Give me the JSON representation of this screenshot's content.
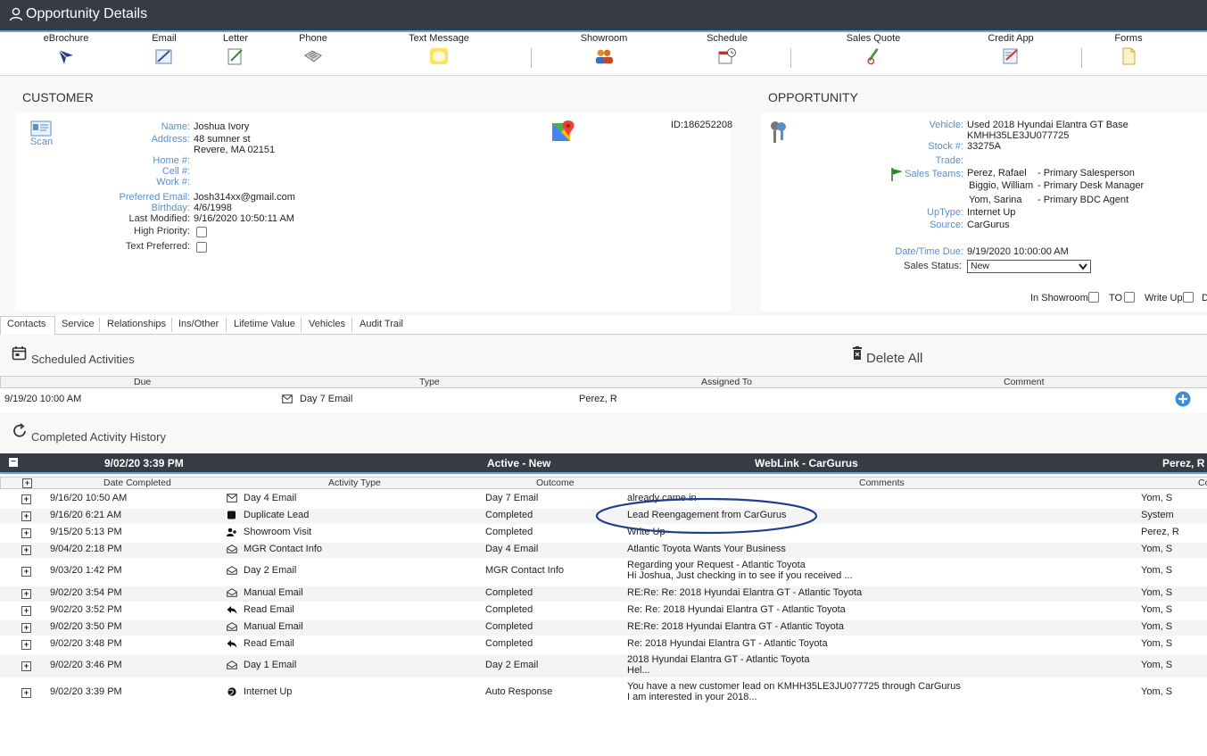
{
  "window": {
    "title": "Opportunity Details"
  },
  "toolbar": [
    {
      "label": "eBrochure"
    },
    {
      "label": "Email"
    },
    {
      "label": "Letter"
    },
    {
      "label": "Phone"
    },
    {
      "label": "Text Message"
    },
    {
      "label": "Showroom"
    },
    {
      "label": "Schedule"
    },
    {
      "label": "Sales Quote"
    },
    {
      "label": "Credit App"
    },
    {
      "label": "Forms"
    }
  ],
  "customer": {
    "header": "CUSTOMER",
    "scan_label": "Scan",
    "id": "ID:186252208",
    "name_label": "Name:",
    "name": "Joshua Ivory",
    "address_label": "Address:",
    "address1": "48 sumner st",
    "address2": "Revere, MA 02151",
    "home_label": "Home #:",
    "cell_label": "Cell #:",
    "work_label": "Work #:",
    "email_label": "Preferred Email:",
    "email": "Josh314xx@gmail.com",
    "birthday_label": "Birthday:",
    "birthday": "4/6/1998",
    "modified_label": "Last Modified:",
    "modified": "9/16/2020 10:50:11 AM",
    "priority_label": "High Priority:",
    "text_pref_label": "Text Preferred:"
  },
  "opportunity": {
    "header": "OPPORTUNITY",
    "vehicle_label": "Vehicle:",
    "vehicle": "Used 2018 Hyundai Elantra GT Base",
    "vin": "KMHH35LE3JU077725",
    "stock_label": "Stock #:",
    "stock": "33275A",
    "trade_label": "Trade:",
    "teams_label": "Sales Teams:",
    "teams": [
      {
        "name": "Perez, Rafael",
        "role": "- Primary Salesperson"
      },
      {
        "name": "Biggio, William",
        "role": "- Primary Desk Manager"
      },
      {
        "name": "Yom, Sarina",
        "role": "- Primary BDC Agent"
      }
    ],
    "uptype_label": "UpType:",
    "uptype": "Internet Up",
    "source_label": "Source:",
    "source": "CarGurus",
    "due_label": "Date/Time Due:",
    "due": "9/19/2020 10:00:00 AM",
    "status_label": "Sales Status:",
    "status": "New",
    "in_showroom": "In Showroom",
    "to": "TO",
    "write_up": "Write Up",
    "d": "D"
  },
  "tabs": [
    "Contacts",
    "Service",
    "Relationships",
    "Ins/Other",
    "Lifetime Value",
    "Vehicles",
    "Audit Trail"
  ],
  "scheduled": {
    "title": "Scheduled Activities",
    "delete_all": "Delete All",
    "columns": [
      "Due",
      "Type",
      "Assigned To",
      "Comment"
    ],
    "rows": [
      {
        "due": "9/19/20 10:00 AM",
        "type": "Day 7 Email",
        "assigned": "Perez, R"
      }
    ]
  },
  "history": {
    "title": "Completed Activity History",
    "group": {
      "date": "9/02/20 3:39 PM",
      "status": "Active - New",
      "source": "WebLink - CarGurus",
      "owner": "Perez, R"
    },
    "columns": [
      "Date Completed",
      "Activity Type",
      "Outcome",
      "Comments",
      "Co"
    ],
    "rows": [
      {
        "date": "9/16/20 10:50 AM",
        "icon": "envelope-icon",
        "type": "Day 4 Email",
        "outcome": "Day 7 Email",
        "c1": "already came in",
        "c2": "",
        "by": "Yom, S"
      },
      {
        "date": "9/16/20 6:21 AM",
        "icon": "square-icon",
        "type": "Duplicate Lead",
        "outcome": "Completed",
        "c1": "Lead Reengagement from CarGurus",
        "c2": "",
        "by": "System"
      },
      {
        "date": "9/15/20 5:13 PM",
        "icon": "person-add-icon",
        "type": "Showroom Visit",
        "outcome": "Completed",
        "c1": "Write Up",
        "c2": "",
        "by": "Perez, R"
      },
      {
        "date": "9/04/20 2:18 PM",
        "icon": "envelope-open-icon",
        "type": "MGR Contact Info",
        "outcome": "Day 4 Email",
        "c1": "Atlantic Toyota Wants Your Business",
        "c2": "",
        "by": "Yom, S"
      },
      {
        "date": "9/03/20 1:42 PM",
        "icon": "envelope-open-icon",
        "type": "Day 2 Email",
        "outcome": "MGR Contact Info",
        "c1": "Regarding your Request - Atlantic Toyota",
        "c2": "Hi Joshua, Just checking in to see if you received ...",
        "by": "Yom, S"
      },
      {
        "date": "9/02/20 3:54 PM",
        "icon": "envelope-open-icon",
        "type": "Manual Email",
        "outcome": "Completed",
        "c1": "RE:Re: Re: 2018 Hyundai Elantra GT - Atlantic Toyota",
        "c2": "",
        "by": "Yom, S"
      },
      {
        "date": "9/02/20 3:52 PM",
        "icon": "reply-icon",
        "type": "Read Email",
        "outcome": "Completed",
        "c1": "Re: Re: 2018 Hyundai Elantra GT - Atlantic Toyota",
        "c2": "",
        "by": "Yom, S"
      },
      {
        "date": "9/02/20 3:50 PM",
        "icon": "envelope-open-icon",
        "type": "Manual Email",
        "outcome": "Completed",
        "c1": "RE:Re: 2018 Hyundai Elantra GT - Atlantic Toyota",
        "c2": "",
        "by": "Yom, S"
      },
      {
        "date": "9/02/20 3:48 PM",
        "icon": "reply-icon",
        "type": "Read Email",
        "outcome": "Completed",
        "c1": "Re: 2018 Hyundai Elantra GT - Atlantic Toyota",
        "c2": "",
        "by": "Yom, S"
      },
      {
        "date": "9/02/20 3:46 PM",
        "icon": "envelope-open-icon",
        "type": "Day 1 Email",
        "outcome": "Day 2 Email",
        "c1": "2018 Hyundai Elantra GT - Atlantic Toyota",
        "c2": "Hel...",
        "by": "Yom, S"
      },
      {
        "date": "9/02/20 3:39 PM",
        "icon": "globe-icon",
        "type": "Internet Up",
        "outcome": "Auto Response",
        "c1": "You have a new customer lead on KMHH35LE3JU077725 through CarGurus",
        "c2": "I am interested in your 2018...",
        "by": "Yom, S"
      }
    ]
  },
  "colors": {
    "titlebar": "#373b44",
    "accent": "#5aa7d8",
    "label": "#5b8fc7",
    "annotation": "#1f3f8f"
  }
}
